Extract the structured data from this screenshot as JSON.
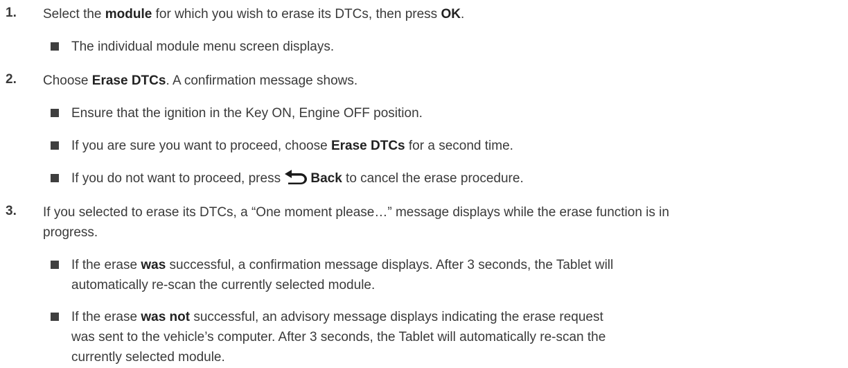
{
  "steps": [
    {
      "number": "1.",
      "text_before": "Select the ",
      "bold1": "module",
      "text_middle": " for which you wish to erase its DTCs, then press ",
      "bold2": "OK",
      "text_after": ".",
      "bullets": [
        {
          "text": "The individual module menu screen displays."
        }
      ]
    },
    {
      "number": "2.",
      "text_before": "Choose ",
      "bold1": "Erase DTCs",
      "text_after": ". A confirmation message shows.",
      "bullets": [
        {
          "text": "Ensure that the ignition in the Key ON, Engine OFF position."
        },
        {
          "before": "If you are sure you want to proceed, choose ",
          "bold": "Erase DTCs",
          "after": " for a second time."
        },
        {
          "before": "If you do not want to proceed, press ",
          "bold": "Back",
          "after": " to cancel the erase procedure.",
          "icon": "back-arrow-icon"
        }
      ]
    },
    {
      "number": "3.",
      "line1": "If you selected to erase its DTCs, a “One moment please…” message displays while the erase function is in",
      "line2": "progress.",
      "bullets": [
        {
          "before": "If the erase ",
          "bold": "was",
          "after_line1": " successful, a confirmation message displays. After 3 seconds, the Tablet will",
          "line2": "automatically re-scan the currently selected module."
        },
        {
          "before": "If the erase ",
          "bold": "was not",
          "after_line1": " successful, an advisory message displays indicating the erase request",
          "line2": "was sent to the vehicle’s computer. After 3 seconds, the Tablet will automatically re-scan the",
          "line3": "currently selected module."
        }
      ]
    }
  ]
}
